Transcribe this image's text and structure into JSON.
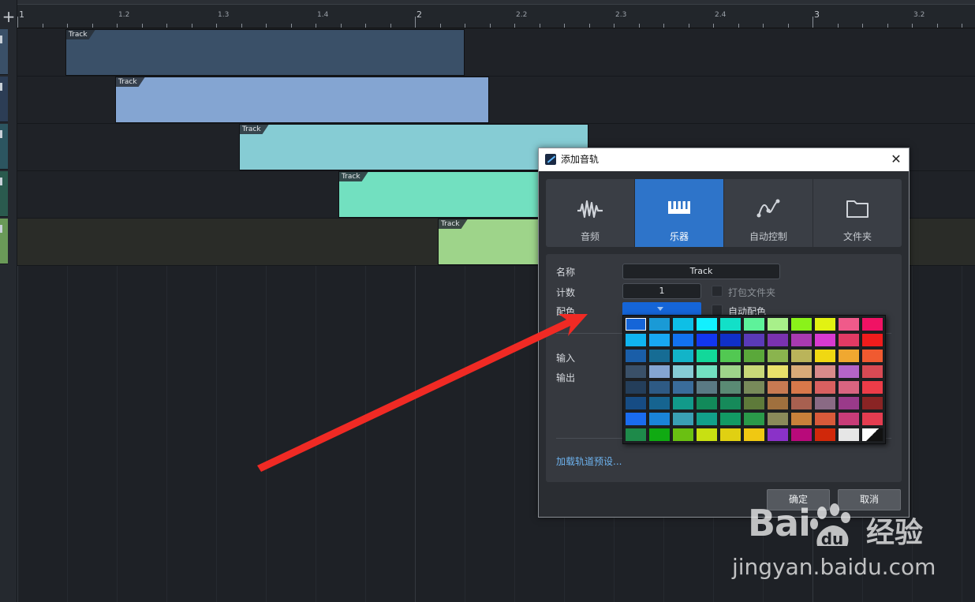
{
  "ruler": {
    "labels": [
      "1",
      "1.2",
      "1.3",
      "1.4",
      "2",
      "2.2",
      "2.3",
      "2.4",
      "3",
      "3.2"
    ]
  },
  "add_button_label": "+",
  "clips": [
    {
      "label": "Track",
      "color": "#3a5068"
    },
    {
      "label": "Track",
      "color": "#84a5d2"
    },
    {
      "label": "Track",
      "color": "#86ccd4"
    },
    {
      "label": "Track",
      "color": "#72e0c0"
    },
    {
      "label": "Track",
      "color": "#9ed48a"
    }
  ],
  "dialog": {
    "title": "添加音轨",
    "close_glyph": "✕",
    "tabs": [
      {
        "label": "音频",
        "icon": "waveform-icon",
        "active": false
      },
      {
        "label": "乐器",
        "icon": "piano-keys-icon",
        "active": true
      },
      {
        "label": "自动控制",
        "icon": "automation-curve-icon",
        "active": false
      },
      {
        "label": "文件夹",
        "icon": "folder-icon",
        "active": false
      }
    ],
    "name_label": "名称",
    "name_value": "Track",
    "count_label": "计数",
    "count_value": "1",
    "pack_folder_label": "打包文件夹",
    "color_label": "配色",
    "auto_color_label": "自动配色",
    "input_label": "输入",
    "output_label": "输出",
    "preset_link": "加载轨道预设...",
    "ok_label": "确定",
    "cancel_label": "取消",
    "selected_color": "#1565d8"
  },
  "palette": {
    "rows": [
      [
        "#1565d8",
        "#1a9ad6",
        "#0ebfe6",
        "#12f0ff",
        "#12e0c8",
        "#5ef29a",
        "#a8f08a",
        "#8af21a",
        "#e2f212",
        "#f05a8a",
        "#f01264"
      ],
      [
        "#10b4f0",
        "#18a8f2",
        "#1272f0",
        "#1236f0",
        "#1030c8",
        "#5a3ab8",
        "#7a32b0",
        "#a83ab0",
        "#d83ad0",
        "#e03a64",
        "#f01c1c"
      ],
      [
        "#1a5ea8",
        "#166c94",
        "#12b4c8",
        "#12d89a",
        "#52c852",
        "#5aa83a",
        "#8ab44e",
        "#bab45a",
        "#f0d812",
        "#f0a830",
        "#f05a30"
      ],
      [
        "#3a5068",
        "#84a5d2",
        "#86ccd4",
        "#72e0c0",
        "#9ed48a",
        "#c8d878",
        "#e8e06a",
        "#d8aa78",
        "#d88a8a",
        "#b464c8",
        "#d84a54"
      ],
      [
        "#243e5a",
        "#2e5a84",
        "#3a6c9a",
        "#5a7a84",
        "#5a8a74",
        "#788a5a",
        "#c87a52",
        "#d8784a",
        "#d86060",
        "#d86480",
        "#ec3c48"
      ],
      [
        "#164c84",
        "#166490",
        "#129a8a",
        "#128a5a",
        "#168a5a",
        "#5e7a3a",
        "#a0703e",
        "#a86050",
        "#8a6a84",
        "#9a3a8a",
        "#8a2424"
      ],
      [
        "#1a6cf0",
        "#1a84d8",
        "#3aa0b4",
        "#12a08a",
        "#129a64",
        "#2a9a4a",
        "#8a8a5a",
        "#c8803a",
        "#d85a3a",
        "#c83c78",
        "#e43c50"
      ],
      [
        "#1e8a4a",
        "#10aa12",
        "#6ac012",
        "#c8e012",
        "#e0d012",
        "#f0c812",
        "#8a32c8",
        "#b80a7a",
        "#d0280a",
        "#e6e6e6",
        "#none"
      ]
    ]
  },
  "watermark": {
    "logo_left": "Bai",
    "logo_mid": "du",
    "logo_right": "经验",
    "url": "jingyan.baidu.com"
  }
}
